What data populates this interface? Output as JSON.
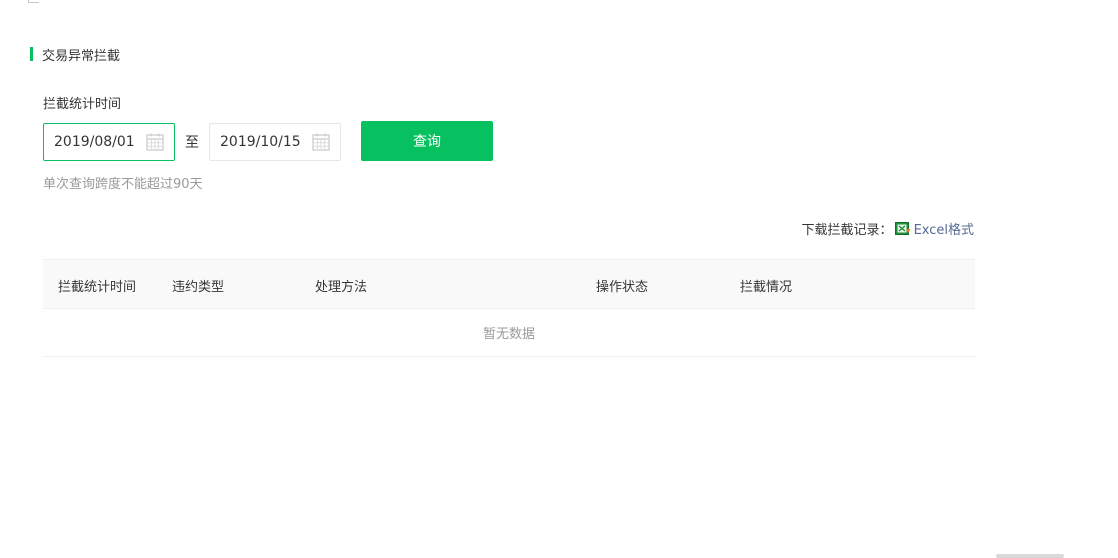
{
  "section": {
    "title": "交易异常拦截"
  },
  "filter": {
    "label": "拦截统计时间",
    "start_date": "2019/08/01",
    "separator": "至",
    "end_date": "2019/10/15",
    "query_label": "查询",
    "hint": "单次查询跨度不能超过90天"
  },
  "download": {
    "label": "下载拦截记录：",
    "link_label": "Excel格式",
    "icon": "excel-file-icon"
  },
  "table": {
    "columns": [
      "拦截统计时间",
      "违约类型",
      "处理方法",
      "操作状态",
      "拦截情况"
    ],
    "empty_text": "暂无数据"
  },
  "colors": {
    "accent": "#07c160",
    "link": "#576b95",
    "muted": "#9a9a9a"
  }
}
